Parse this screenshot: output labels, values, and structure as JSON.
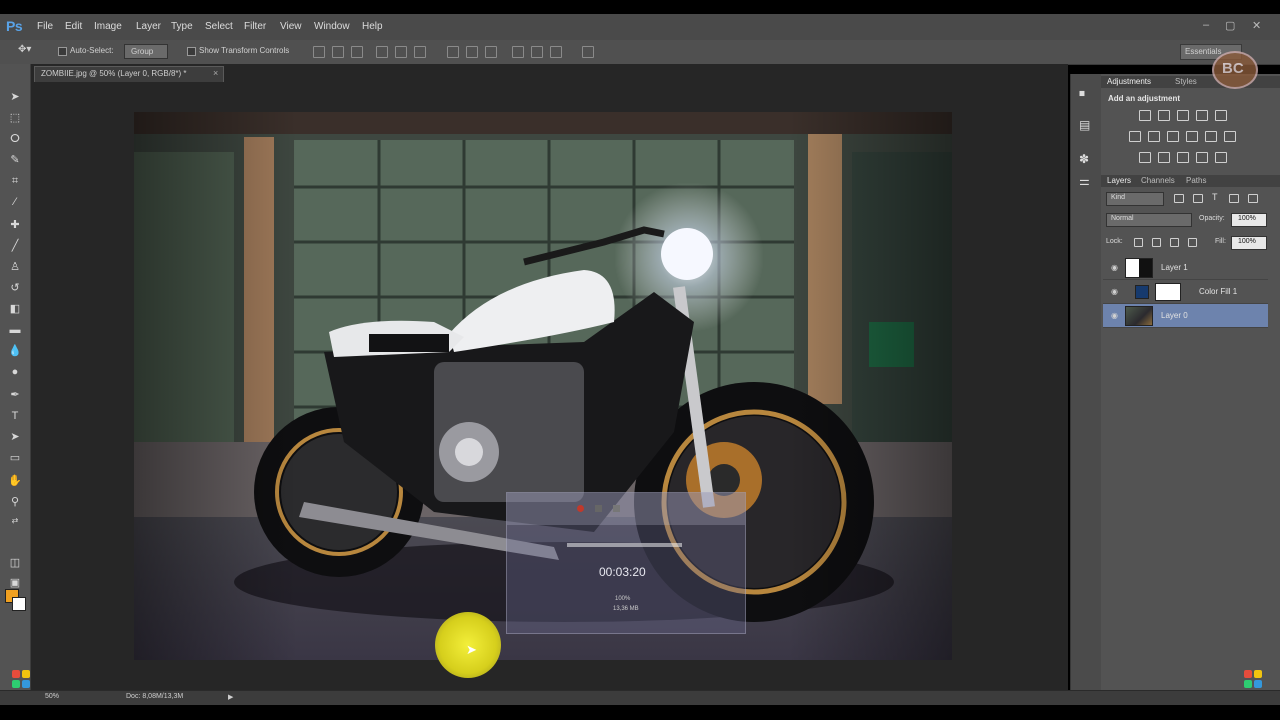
{
  "app": {
    "logo": "Ps"
  },
  "menu": [
    "File",
    "Edit",
    "Image",
    "Layer",
    "Type",
    "Select",
    "Filter",
    "View",
    "Window",
    "Help"
  ],
  "window_controls": [
    "–",
    "▢",
    "✕"
  ],
  "options_bar": {
    "auto_select_label": "Auto-Select:",
    "group_value": "Group",
    "show_transform_label": "Show Transform Controls",
    "workspace": "Essentials"
  },
  "document": {
    "tab_label": "ZOMBIIE.jpg @ 50% (Layer 0, RGB/8*) *",
    "close": "×"
  },
  "status": {
    "zoom": "50%",
    "doc_info": "Doc: 8,08M/13,3M"
  },
  "overlay": {
    "timer": "00:03:20",
    "line1": "100%",
    "line2": "13,36 MB"
  },
  "watermark": "BC",
  "panels": {
    "adjustments": {
      "tabs": [
        "Adjustments",
        "Styles"
      ],
      "heading": "Add an adjustment"
    },
    "layers": {
      "tabs": [
        "Layers",
        "Channels",
        "Paths"
      ],
      "kind": "Kind",
      "blend_mode": "Normal",
      "opacity_label": "Opacity:",
      "opacity_value": "100%",
      "lock_label": "Lock:",
      "fill_label": "Fill:",
      "fill_value": "100%",
      "items": [
        {
          "name": "Layer 1",
          "selected": false
        },
        {
          "name": "Color Fill 1",
          "selected": false
        },
        {
          "name": "Layer 0",
          "selected": true
        }
      ]
    }
  },
  "colors": {
    "foreground": "#f0a020",
    "background": "#ffffff",
    "selection": "#6d83ad"
  }
}
